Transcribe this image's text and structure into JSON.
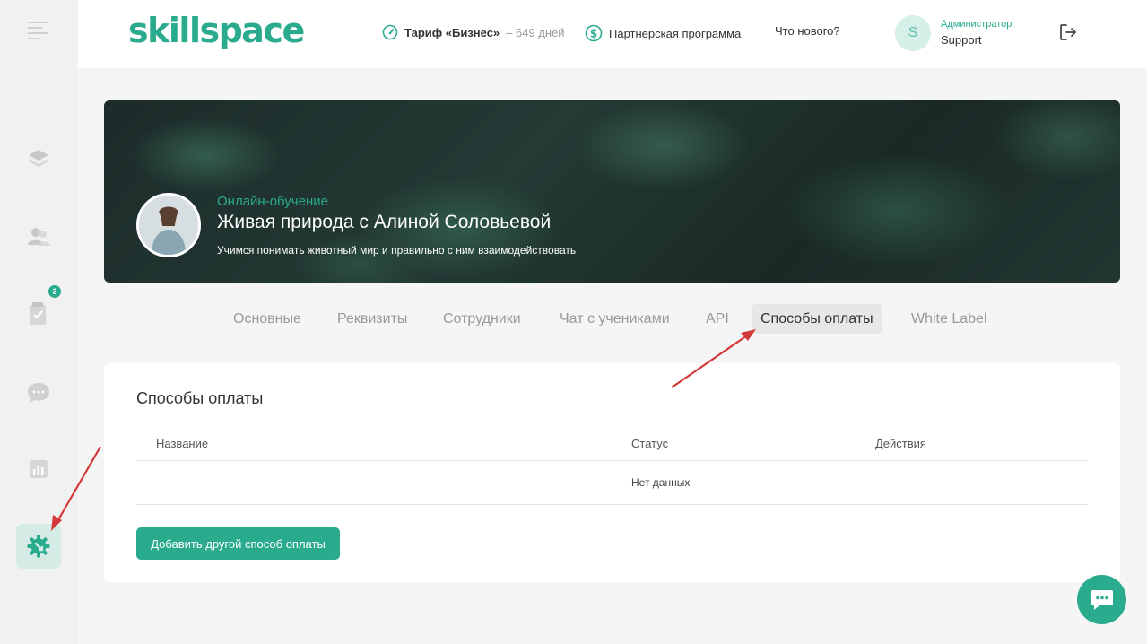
{
  "brand": {
    "logo": "skillspace",
    "accent": "#2aab8e"
  },
  "sidebar": {
    "items": [
      {
        "icon": "menu-icon"
      },
      {
        "icon": "layers-icon"
      },
      {
        "icon": "users-icon"
      },
      {
        "icon": "tasks-icon",
        "badge": "3"
      },
      {
        "icon": "chat-icon"
      },
      {
        "icon": "stats-icon"
      },
      {
        "icon": "settings-icon",
        "active": true
      }
    ]
  },
  "header": {
    "tariff_label": "Тариф «Бизнес»",
    "tariff_days": "– 649 дней",
    "partner_label": "Партнерская программа",
    "whats_new": "Что нового?",
    "avatar_letter": "S",
    "role": "Администратор",
    "username": "Support"
  },
  "banner": {
    "subtitle": "Онлайн-обучение",
    "title": "Живая природа с Алиной Соловьевой",
    "description": "Учимся понимать животный мир и правильно с ним взаимодействовать"
  },
  "tabs": [
    {
      "label": "Основные"
    },
    {
      "label": "Реквизиты"
    },
    {
      "label": "Сотрудники"
    },
    {
      "label": "Чат с учениками"
    },
    {
      "label": "API"
    },
    {
      "label": "Способы оплаты",
      "active": true
    },
    {
      "label": "White Label"
    }
  ],
  "payments": {
    "title": "Способы оплаты",
    "columns": [
      "Название",
      "Статус",
      "Действия"
    ],
    "empty_text": "Нет данных",
    "add_button": "Добавить другой способ оплаты"
  }
}
